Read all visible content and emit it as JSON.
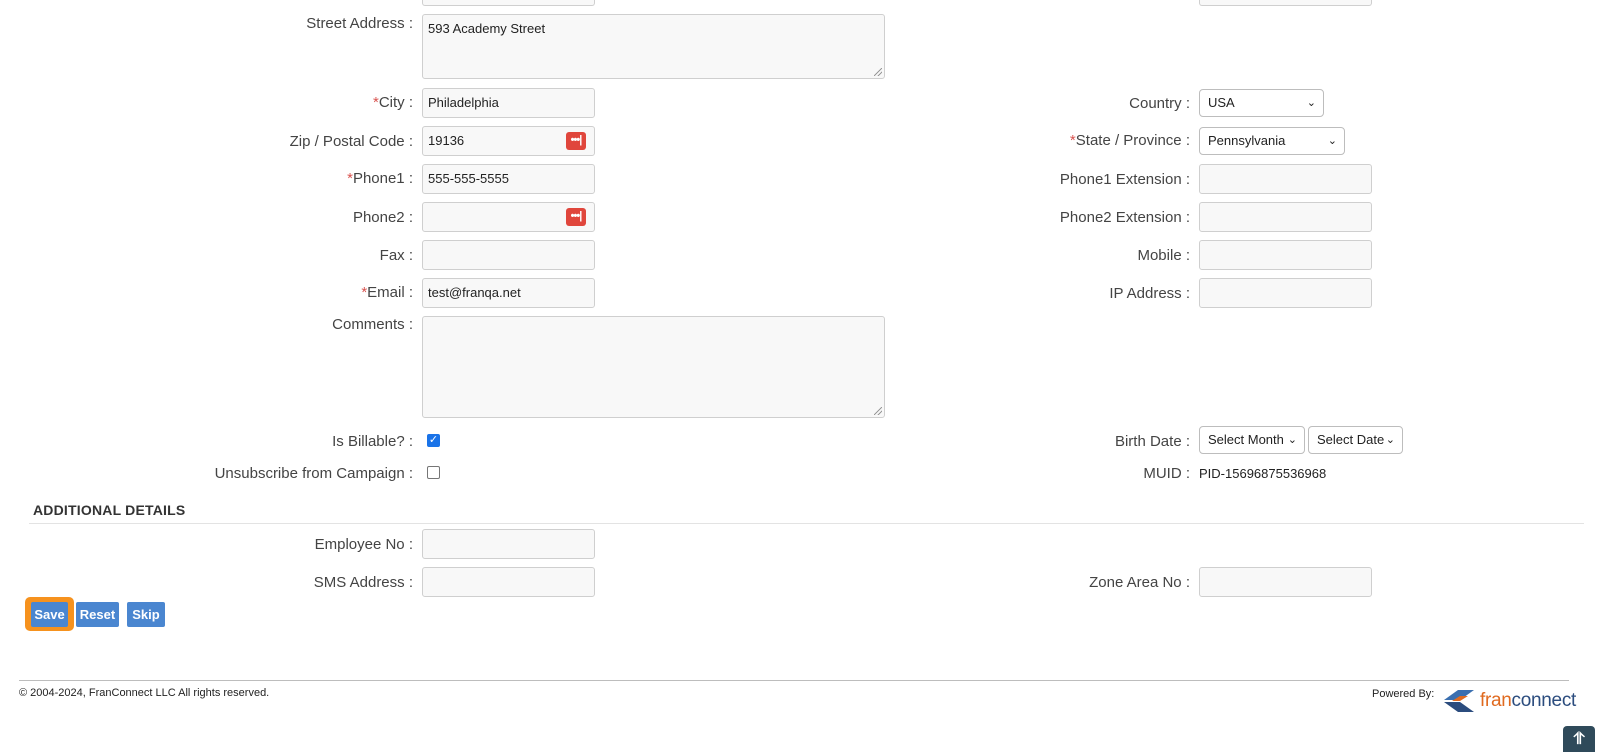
{
  "form": {
    "street_address": {
      "label": "Street Address :",
      "value": "593 Academy Street"
    },
    "city": {
      "required_mark": "*",
      "label": "City :",
      "value": "Philadelphia"
    },
    "country": {
      "label": "Country :",
      "value": "USA"
    },
    "zip": {
      "label": "Zip / Postal Code :",
      "value": "19136"
    },
    "state": {
      "required_mark": "*",
      "label": "State / Province :",
      "value": "Pennsylvania"
    },
    "phone1": {
      "required_mark": "*",
      "label": "Phone1 :",
      "value": "555-555-5555"
    },
    "phone1_ext": {
      "label": "Phone1 Extension :",
      "value": ""
    },
    "phone2": {
      "label": "Phone2 :",
      "value": ""
    },
    "phone2_ext": {
      "label": "Phone2 Extension :",
      "value": ""
    },
    "fax": {
      "label": "Fax :",
      "value": ""
    },
    "mobile": {
      "label": "Mobile :",
      "value": ""
    },
    "email": {
      "required_mark": "*",
      "label": "Email :",
      "value": "test@franqa.net"
    },
    "ip_address": {
      "label": "IP Address :",
      "value": ""
    },
    "comments": {
      "label": "Comments :",
      "value": ""
    },
    "is_billable": {
      "label": "Is Billable? :",
      "checked": true
    },
    "unsubscribe": {
      "label": "Unsubscribe from Campaign :",
      "checked": false
    },
    "birth_date": {
      "label": "Birth Date :",
      "month": "Select Month",
      "date": "Select Date"
    },
    "muid": {
      "label": "MUID :",
      "value": "PID-15696875536968"
    }
  },
  "additional": {
    "title": "ADDITIONAL DETAILS",
    "employee_no": {
      "label": "Employee No :",
      "value": ""
    },
    "sms_address": {
      "label": "SMS Address :",
      "value": ""
    },
    "zone_area_no": {
      "label": "Zone Area No :",
      "value": ""
    }
  },
  "buttons": {
    "save": "Save",
    "reset": "Reset",
    "skip": "Skip"
  },
  "footer": {
    "copyright": "© 2004-2024, FranConnect LLC All rights reserved.",
    "powered_by": "Powered By:",
    "logo_fran": "fran",
    "logo_connect": "connect"
  },
  "icons": {
    "password_manager": "password-manager-icon",
    "scroll_top": "double-chevron-up-icon",
    "dropdown": "chevron-down-icon"
  },
  "colors": {
    "required": "#d9534f",
    "button": "#4a86d0",
    "focus_ring": "#f6921e",
    "password_manager": "#e0463c"
  }
}
